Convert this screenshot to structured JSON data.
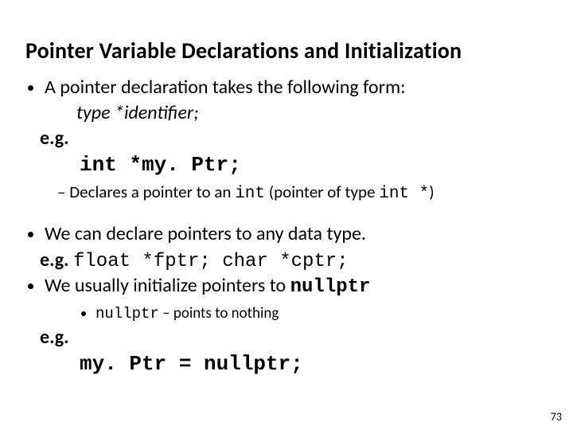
{
  "title": "Pointer Variable Declarations and Initialization",
  "bullet1": "A pointer declaration takes the following form:",
  "form_line": "type    *identifier;",
  "eg1": "e.g.",
  "code1": "int *my. Ptr;",
  "sub1_a": "Declares a pointer to an ",
  "sub1_code1": "int",
  "sub1_b": " (pointer of type ",
  "sub1_code2": "int *",
  "sub1_c": ")",
  "bullet2": "We can declare pointers to any data type.",
  "eg2_label": "e.g. ",
  "eg2_code": "float *fptr;   char *cptr;",
  "bullet3_a": "We usually initialize pointers to ",
  "bullet3_code": "nullptr",
  "subsub_code": "nullptr",
  "subsub_b": " – points to nothing",
  "eg3": "e.g.",
  "code3": "my. Ptr = nullptr;",
  "pagenum": "73"
}
